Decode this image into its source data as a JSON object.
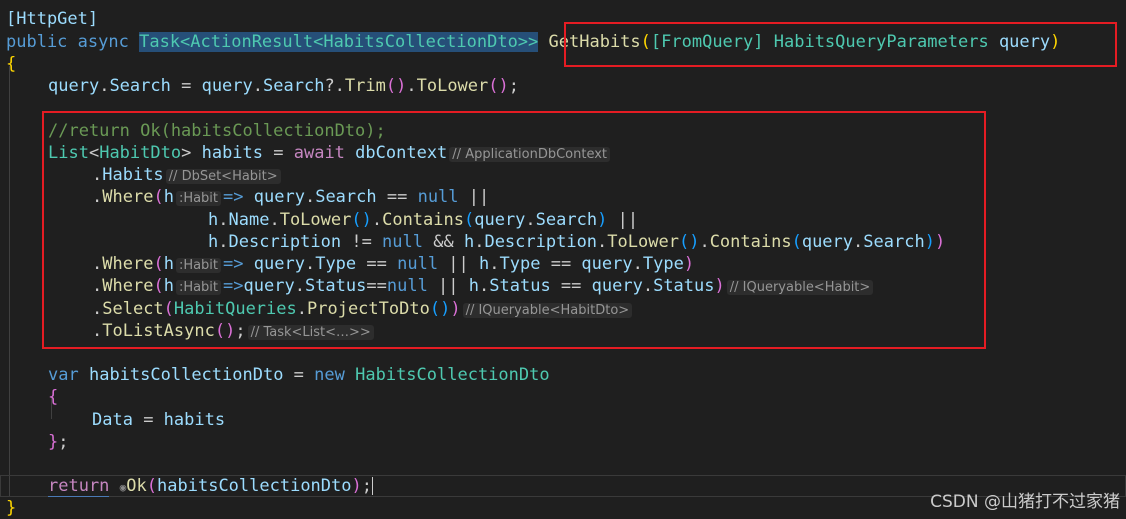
{
  "editor": {
    "attribute": "[HttpGet]",
    "kw_public": "public",
    "kw_async": "async",
    "return_type": "Task<ActionResult<HabitsCollectionDto>>",
    "method_name": "GetHabits",
    "from_query": "[FromQuery]",
    "param_type": "HabitsQueryParameters",
    "param_name": "query",
    "line_search": "query.Search = query.Search?.Trim().ToLower();",
    "comment_return": "//return Ok(habitsCollectionDto);",
    "hint_dbcontext": "// ApplicationDbContext",
    "hint_dbset": "// DbSet<Habit>",
    "hint_habit": ":Habit",
    "hint_iqueryable_habit": "// IQueryable<Habit>",
    "hint_iqueryable_dto": "// IQueryable<HabitDto>",
    "hint_task_list": "// Task<List<…>>",
    "watermark": "CSDN @山猪打不过家猪"
  }
}
